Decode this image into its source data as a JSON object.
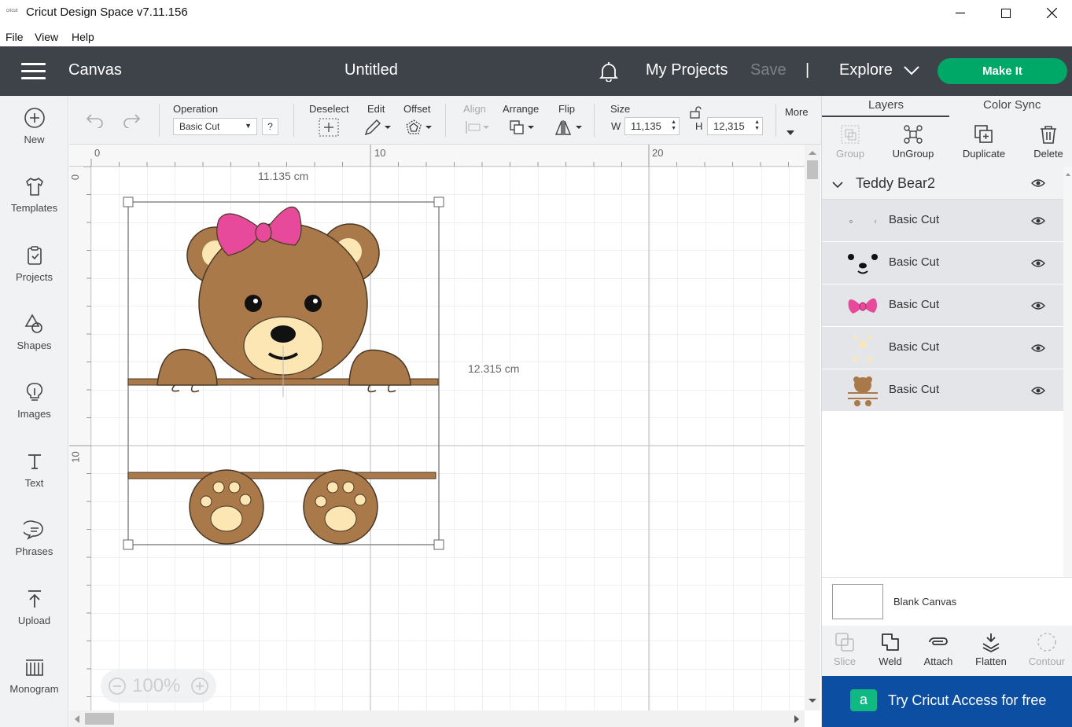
{
  "window": {
    "app_icon_text": "cricut",
    "title": "Cricut Design Space  v7.11.156"
  },
  "menu": [
    "File",
    "View",
    "Help"
  ],
  "header": {
    "canvas_label": "Canvas",
    "doc_title": "Untitled",
    "my_projects": "My Projects",
    "save": "Save",
    "divider": "|",
    "explore": "Explore",
    "make_it": "Make It"
  },
  "sidebar": {
    "items": [
      {
        "label": "New",
        "icon": "plus-circle-icon"
      },
      {
        "label": "Templates",
        "icon": "shirt-icon"
      },
      {
        "label": "Projects",
        "icon": "clipboard-icon"
      },
      {
        "label": "Shapes",
        "icon": "shapes-icon"
      },
      {
        "label": "Images",
        "icon": "lightbulb-icon"
      },
      {
        "label": "Text",
        "icon": "text-icon"
      },
      {
        "label": "Phrases",
        "icon": "speech-bubble-icon"
      },
      {
        "label": "Upload",
        "icon": "upload-icon"
      },
      {
        "label": "Monogram",
        "icon": "monogram-icon"
      }
    ]
  },
  "toolbar": {
    "operation_label": "Operation",
    "operation_value": "Basic Cut",
    "help": "?",
    "deselect": "Deselect",
    "edit": "Edit",
    "offset": "Offset",
    "align": "Align",
    "arrange": "Arrange",
    "flip": "Flip",
    "size": "Size",
    "w_label": "W",
    "w_value": "11,135",
    "h_label": "H",
    "h_value": "12,315",
    "more": "More"
  },
  "canvas": {
    "ruler_top": [
      "0",
      "10",
      "20"
    ],
    "ruler_left": [
      "0",
      "10"
    ],
    "width_label": "11.135 cm",
    "height_label": "12.315 cm",
    "zoom": "100%"
  },
  "right_panel": {
    "tabs": [
      "Layers",
      "Color Sync"
    ],
    "actions": [
      {
        "label": "Group",
        "enabled": false
      },
      {
        "label": "UnGroup",
        "enabled": true
      },
      {
        "label": "Duplicate",
        "enabled": true
      },
      {
        "label": "Delete",
        "enabled": true
      }
    ],
    "group_name": "Teddy Bear2",
    "layers": [
      {
        "name": "Basic Cut",
        "thumb": "dots"
      },
      {
        "name": "Basic Cut",
        "thumb": "face"
      },
      {
        "name": "Basic Cut",
        "thumb": "bow"
      },
      {
        "name": "Basic Cut",
        "thumb": "cream"
      },
      {
        "name": "Basic Cut",
        "thumb": "bear"
      }
    ],
    "blank_canvas": "Blank Canvas",
    "bottom_actions": [
      {
        "label": "Slice",
        "enabled": false
      },
      {
        "label": "Weld",
        "enabled": true
      },
      {
        "label": "Attach",
        "enabled": true
      },
      {
        "label": "Flatten",
        "enabled": true
      },
      {
        "label": "Contour",
        "enabled": false
      }
    ],
    "access_banner": "Try Cricut Access for free",
    "access_logo": "a"
  },
  "colors": {
    "header_bg": "#3e4249",
    "make_it": "#00a868",
    "bear_brown": "#a9794a",
    "bear_cream": "#fbe6b4",
    "bow_pink": "#e84a9b",
    "access_blue": "#0b4ea2"
  }
}
